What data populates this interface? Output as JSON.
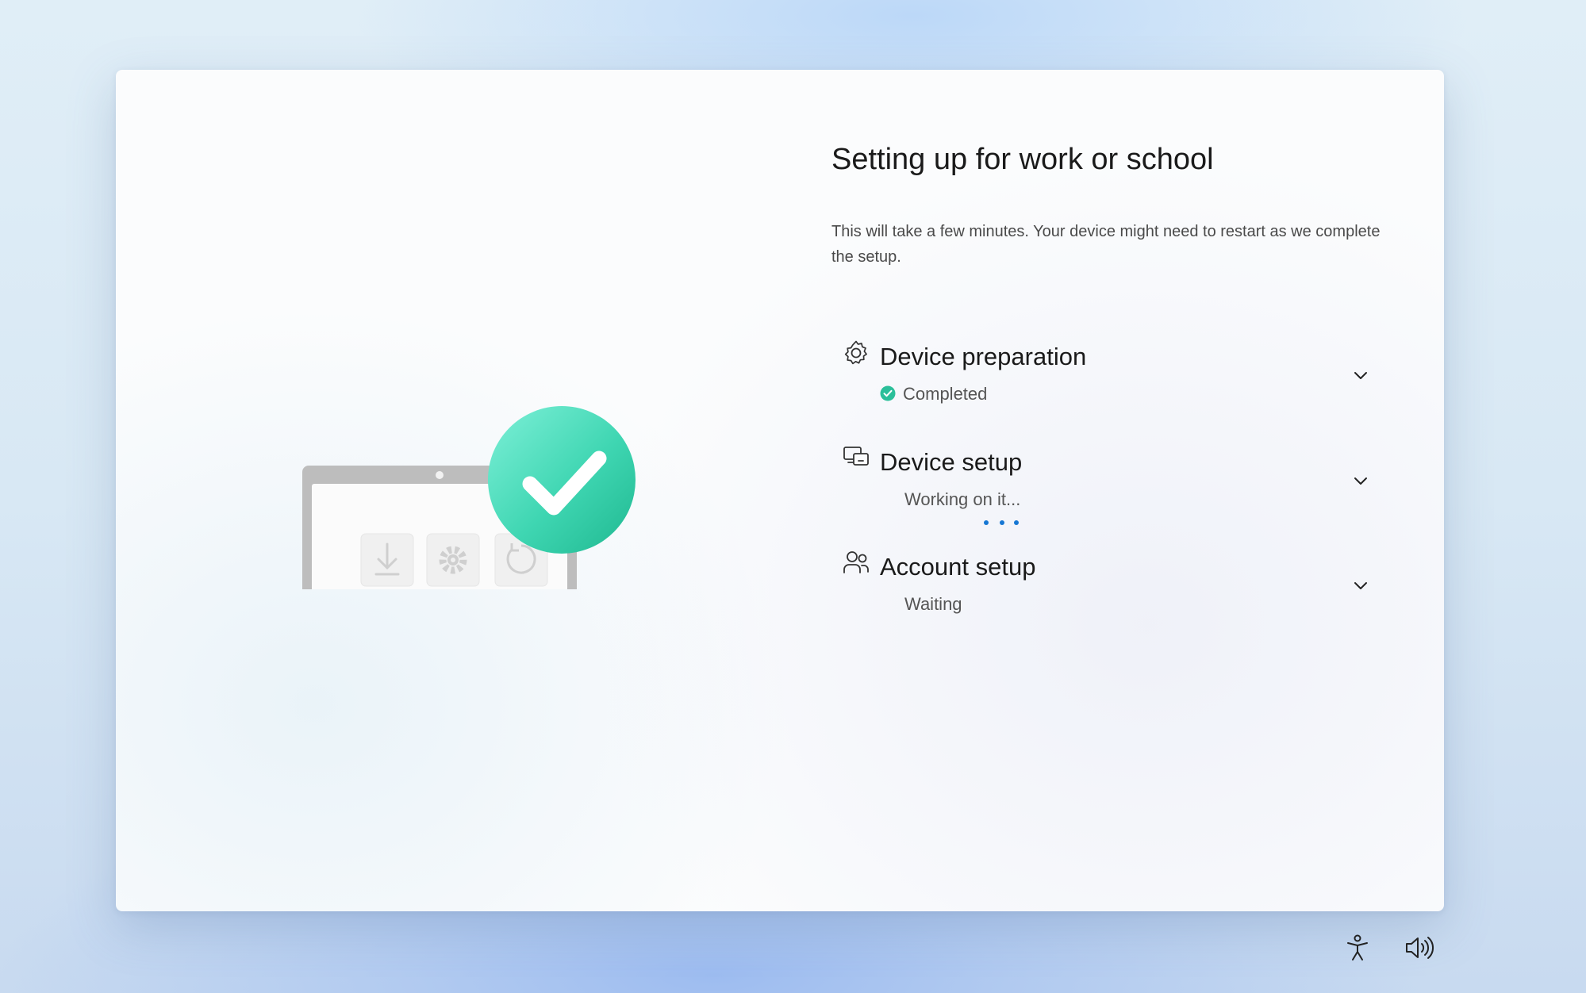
{
  "page": {
    "title": "Setting up for work or school",
    "subtitle": "This will take a few minutes. Your device might need to restart as we complete the setup."
  },
  "steps": [
    {
      "label": "Device preparation",
      "status": "Completed",
      "icon": "gear-icon",
      "state": "completed"
    },
    {
      "label": "Device setup",
      "status": "Working on it...",
      "icon": "device-icon",
      "state": "in-progress"
    },
    {
      "label": "Account setup",
      "status": "Waiting",
      "icon": "people-icon",
      "state": "waiting"
    }
  ],
  "bottom_bar": {
    "accessibility_icon": "accessibility-icon",
    "volume_icon": "volume-icon"
  },
  "colors": {
    "accent": "#1677d3",
    "success": "#2bbf9a"
  }
}
